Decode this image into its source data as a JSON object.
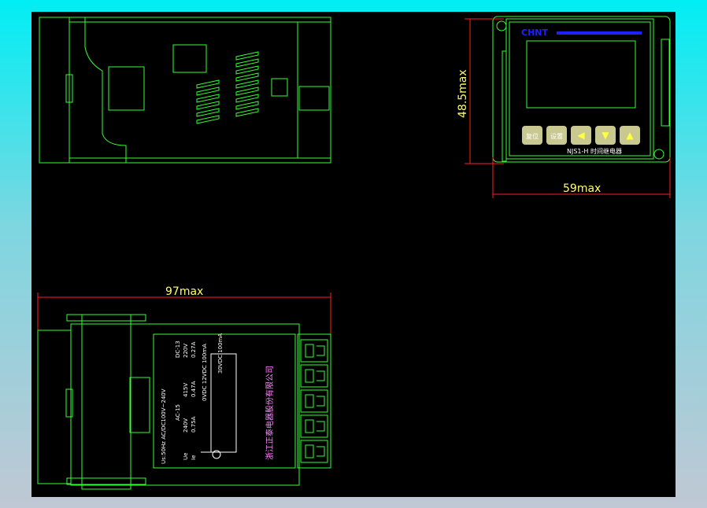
{
  "dimensions": {
    "width_label": "97max",
    "height_label": "48.5max",
    "front_width_label": "59max"
  },
  "front_panel": {
    "brand": "CHNT",
    "model": "NJS1-H 时间继电器",
    "buttons": [
      "复位",
      "设置",
      "◀",
      "▼",
      "▲"
    ]
  },
  "side_label": {
    "supply": "Us:50Hz AC/DC100V~240V",
    "headers": [
      "AC-15",
      "DC-13"
    ],
    "row_ue": [
      "Ue",
      "240V",
      "415V",
      "220V"
    ],
    "row_ie": [
      "Ie",
      "0.75A",
      "0.47A",
      "0.27A"
    ],
    "outputs": [
      "0VDC 12VDC 100mA",
      "30VDC 100mA"
    ],
    "manufacturer": "浙江正泰电器股份有限公司"
  },
  "colors": {
    "line": "#33ff33",
    "dimension": "#ff2020",
    "dim_text": "#ffff66",
    "brand": "#2020ff"
  }
}
